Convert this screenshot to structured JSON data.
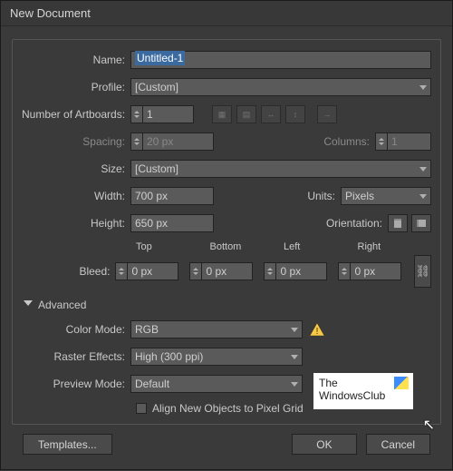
{
  "window_title": "New Document",
  "labels": {
    "name": "Name:",
    "profile": "Profile:",
    "artboards": "Number of Artboards:",
    "spacing": "Spacing:",
    "columns": "Columns:",
    "size": "Size:",
    "width": "Width:",
    "height": "Height:",
    "units": "Units:",
    "orientation": "Orientation:",
    "bleed": "Bleed:",
    "top": "Top",
    "bottom": "Bottom",
    "left": "Left",
    "right": "Right",
    "advanced": "Advanced",
    "color_mode": "Color Mode:",
    "raster_effects": "Raster Effects:",
    "preview_mode": "Preview Mode:",
    "align_grid": "Align New Objects to Pixel Grid"
  },
  "values": {
    "name": "Untitled-1",
    "profile": "[Custom]",
    "artboards": "1",
    "spacing": "20 px",
    "columns": "1",
    "size": "[Custom]",
    "width": "700 px",
    "height": "650 px",
    "units": "Pixels",
    "bleed_top": "0 px",
    "bleed_bottom": "0 px",
    "bleed_left": "0 px",
    "bleed_right": "0 px",
    "color_mode": "RGB",
    "raster_effects": "High (300 ppi)",
    "preview_mode": "Default"
  },
  "buttons": {
    "templates": "Templates...",
    "ok": "OK",
    "cancel": "Cancel"
  },
  "logo": {
    "line1": "The",
    "line2": "WindowsClub"
  }
}
